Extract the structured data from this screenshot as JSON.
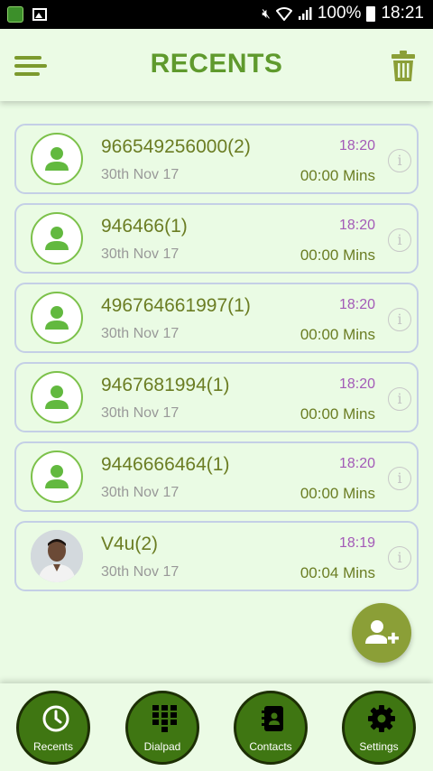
{
  "status_bar": {
    "battery": "100%",
    "clock": "18:21"
  },
  "header": {
    "title": "RECENTS"
  },
  "calls": [
    {
      "name": "966549256000(2)",
      "date": "30th Nov 17",
      "time": "18:20",
      "duration": "00:00 Mins",
      "avatar": "default-user-icon"
    },
    {
      "name": "946466(1)",
      "date": "30th Nov 17",
      "time": "18:20",
      "duration": "00:00 Mins",
      "avatar": "default-user-icon"
    },
    {
      "name": "496764661997(1)",
      "date": "30th Nov 17",
      "time": "18:20",
      "duration": "00:00 Mins",
      "avatar": "default-user-icon"
    },
    {
      "name": "9467681994(1)",
      "date": "30th Nov 17",
      "time": "18:20",
      "duration": "00:00 Mins",
      "avatar": "default-user-icon"
    },
    {
      "name": "9446666464(1)",
      "date": "30th Nov 17",
      "time": "18:20",
      "duration": "00:00 Mins",
      "avatar": "default-user-icon"
    },
    {
      "name": "V4u(2)",
      "date": "30th Nov 17",
      "time": "18:19",
      "duration": "00:04 Mins",
      "avatar": "contact-photo"
    }
  ],
  "info_glyph": "i",
  "nav": [
    {
      "label": "Recents",
      "icon": "clock-icon"
    },
    {
      "label": "Dialpad",
      "icon": "dialpad-icon"
    },
    {
      "label": "Contacts",
      "icon": "contacts-book-icon"
    },
    {
      "label": "Settings",
      "icon": "gear-icon"
    }
  ],
  "colors": {
    "background": "#eafbe4",
    "accent": "#5f9a2d",
    "time": "#a35ab7",
    "nav_button": "#3f7612",
    "fab": "#8b9f37"
  }
}
